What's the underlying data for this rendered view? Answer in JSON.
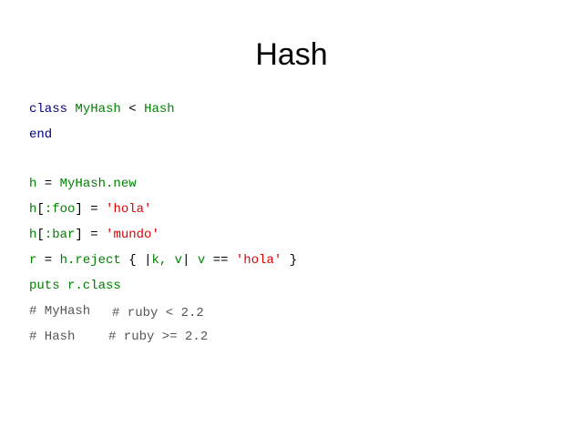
{
  "title": "Hash",
  "code": {
    "l1": {
      "kw": "class",
      "name": "MyHash",
      "op": " < ",
      "parent": "Hash"
    },
    "l2": {
      "kw": "end"
    },
    "l3": {
      "var": "h",
      "op": " = ",
      "expr": "MyHash.new"
    },
    "l4": {
      "pre": "h",
      "br1": "[",
      "key": ":foo",
      "br2": "]",
      "op": " = ",
      "str": "'hola'"
    },
    "l5": {
      "pre": "h",
      "br1": "[",
      "key": ":bar",
      "br2": "]",
      "op": " = ",
      "str": "'mundo'"
    },
    "l6": {
      "var": "r",
      "op1": " = ",
      "recv": "h.reject",
      "brace1": " { ",
      "pipe1": "|",
      "args": "k, v",
      "pipe2": "|",
      "sp": " ",
      "v": "v",
      "eq": " == ",
      "str": "'hola'",
      "brace2": " }"
    },
    "l7": {
      "text": "puts r.class"
    },
    "l8": {
      "a": "# MyHash",
      "b": "# ruby < 2.2"
    },
    "l9": {
      "a": "# Hash",
      "b": "# ruby >= 2.2"
    }
  },
  "colors": {
    "keyword": "#000080",
    "identifier": "#008000",
    "string": "#e00000",
    "comment": "#555555"
  }
}
